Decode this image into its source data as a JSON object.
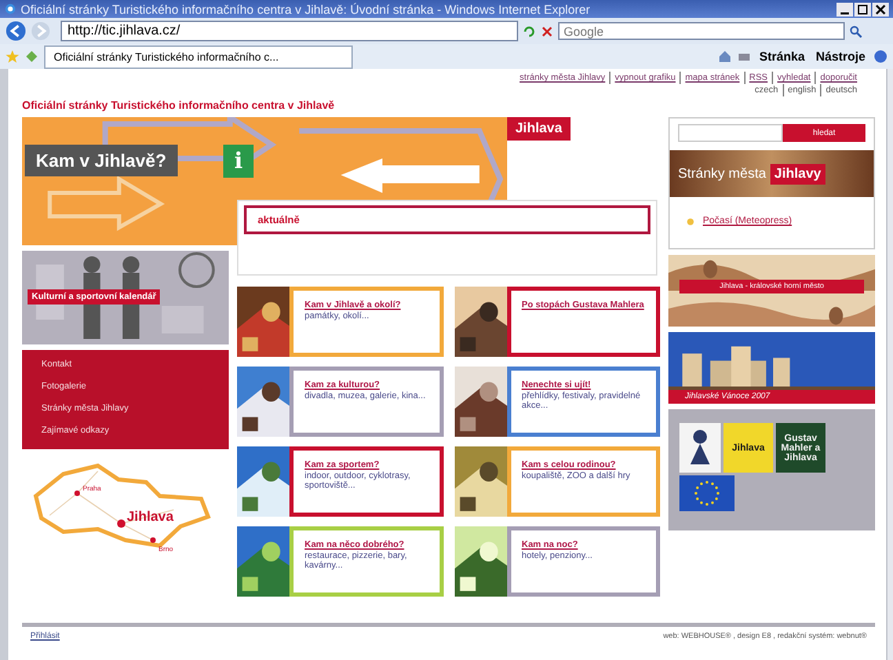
{
  "window": {
    "title": "Oficiální stránky Turistického informačního centra v Jihlavě: Úvodní stránka - Windows Internet Explorer"
  },
  "address_bar": {
    "url": "http://tic.jihlava.cz/"
  },
  "search": {
    "placeholder": "Google"
  },
  "tab": {
    "title": "Oficiální stránky Turistického informačního c..."
  },
  "command_bar": [
    "Stránka",
    "Nástroje"
  ],
  "page": {
    "top_links": [
      "stránky města Jihlavy",
      "vypnout grafiku",
      "mapa stránek",
      "RSS",
      "vyhledat",
      "doporučit"
    ],
    "languages": [
      "czech",
      "english",
      "deutsch"
    ],
    "site_title": "Oficiální stránky Turistického informačního centra v Jihlavě",
    "hero": {
      "title": "Kam v Jihlavě?",
      "info_glyph": "i",
      "city_label": "Jihlava"
    },
    "news": {
      "heading": "aktuálně"
    },
    "calendar": {
      "label": "Kulturní a sportovní kalendář"
    },
    "menu": [
      "Kontakt",
      "Fotogalerie",
      "Stránky města Jihlavy",
      "Zajímavé odkazy"
    ],
    "map": {
      "cities": [
        {
          "name": "Praha",
          "kind": "city"
        },
        {
          "name": "Jihlava",
          "kind": "home"
        },
        {
          "name": "Brno",
          "kind": "city"
        }
      ]
    },
    "cards": [
      {
        "title": "Kam v Jihlavě a okolí?",
        "subtitle": "památky, okolí...",
        "color": "#f2a93b"
      },
      {
        "title": "Po stopách Gustava Mahlera",
        "color": "#c8102e"
      },
      {
        "title": "Kam za kulturou?",
        "subtitle": "divadla, muzea, galerie, kina...",
        "color": "#a59eb4"
      },
      {
        "title": "Nenechte si ujít!",
        "subtitle": "přehlídky, festivaly, pravidelné akce...",
        "color": "#4a7fd0"
      },
      {
        "title": "Kam za sportem?",
        "subtitle": "indoor, outdoor, cyklotrasy, sportoviště...",
        "color": "#c8102e"
      },
      {
        "title": "Kam s celou rodinou?",
        "subtitle": "koupaliště, ZOO a další hry",
        "color": "#f2a93b"
      },
      {
        "title": "Kam na něco dobrého?",
        "subtitle": "restaurace, pizzerie, bary, kavárny...",
        "color": "#a8cf45"
      },
      {
        "title": "Kam na noc?",
        "subtitle": "hotely, penziony...",
        "color": "#a59eb4"
      }
    ],
    "site_search": {
      "button": "hledat"
    },
    "city_banner": {
      "text": "Stránky města",
      "highlight": "Jihlavy"
    },
    "weather_link": "Počasí (Meteopress)",
    "banners": [
      "Jihlava - královské horní město",
      "Jihlavské Vánoce 2007"
    ],
    "logos": [
      {
        "text": "Jihlava",
        "kind": "yellow"
      },
      {
        "text": "Gustav Mahler a Jihlava",
        "kind": "green"
      }
    ],
    "footer": {
      "login": "Přihlásit",
      "credits": "web: WEBHOUSE® , design E8 , redakční systém: webnut®"
    }
  }
}
